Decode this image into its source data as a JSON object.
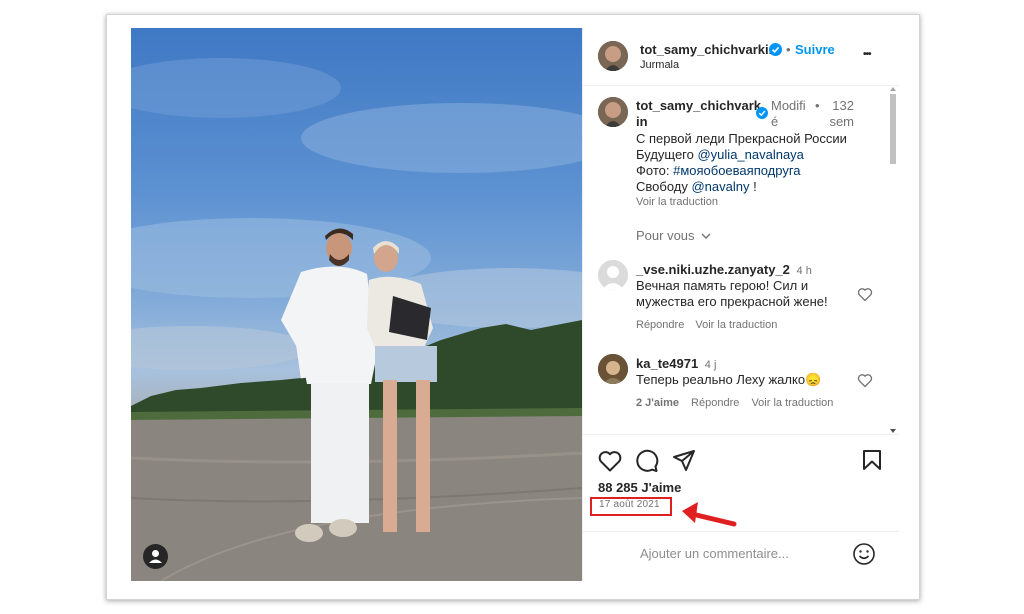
{
  "header": {
    "username": "tot_samy_chichvarkin",
    "separator": "•",
    "follow_label": "Suivre",
    "location": "Jurmala",
    "more_label": "•••"
  },
  "caption": {
    "username_line1": "tot_samy_chichvark",
    "username_line2": "in",
    "edited_line1": "Modifi",
    "edited_line2": "é",
    "dot": "•",
    "age_line1": "132",
    "age_line2": "sem",
    "text_line1": "С первой леди Прекрасной России",
    "text_line2_prefix": "Будущего ",
    "mention1": "@yulia_navalnaya",
    "text_line3_prefix": "Фото: ",
    "hashtag": "#мояобоеваяподруга",
    "text_line4_prefix": "Свободу ",
    "mention2": "@navalny",
    "text_line4_suffix": " !",
    "see_translation": "Voir la traduction"
  },
  "see_more": "Pour vous",
  "comments": [
    {
      "username": "_vse.niki.uzhe.zanyaty_2",
      "time": "4 h",
      "line1": "Вечная память герою! Сил и",
      "line2": "мужества его прекрасной жене!",
      "reply": "Répondre",
      "translate": "Voir la traduction"
    },
    {
      "username": "ka_te4971",
      "time": "4 j",
      "line1": "Теперь реально Леху жалко😞",
      "likes": "2 J'aime",
      "reply": "Répondre",
      "translate": "Voir la traduction"
    }
  ],
  "likes_count": "88 285 J'aime",
  "date": "17 août 2021",
  "comment_placeholder": "Ajouter un commentaire...",
  "icons": {
    "like": "heart-icon",
    "comment": "comment-icon",
    "share": "paper-plane-icon",
    "save": "bookmark-icon",
    "emoji": "smiley-icon",
    "user": "user-icon",
    "arrow": "red-arrow-icon"
  },
  "colors": {
    "accent_blue": "#0095f6",
    "verified_blue": "#0095f6",
    "link_blue": "#00376b",
    "annotation_red": "#e02020"
  }
}
